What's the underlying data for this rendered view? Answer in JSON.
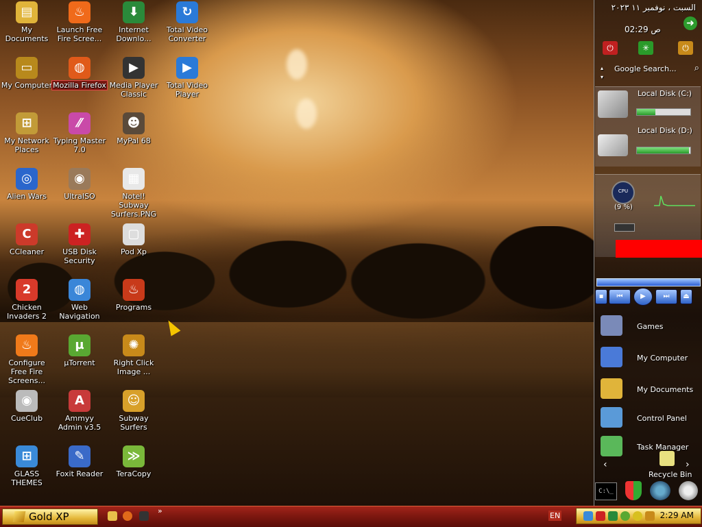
{
  "desktop": {
    "icons": [
      {
        "label": "My Documents",
        "icon": "folder-icon",
        "color": "#e0b43a",
        "glyph": "▤"
      },
      {
        "label": "My Computer",
        "icon": "computer-icon",
        "color": "#b8891c",
        "glyph": "▭"
      },
      {
        "label": "My Network Places",
        "icon": "network-icon",
        "color": "#c29b38",
        "glyph": "⊞"
      },
      {
        "label": "Alien Wars",
        "icon": "alien-wars-icon",
        "color": "#2a66cc",
        "glyph": "◎"
      },
      {
        "label": "CCleaner",
        "icon": "ccleaner-icon",
        "color": "#cc3a2a",
        "glyph": "C"
      },
      {
        "label": "Chicken Invaders 2",
        "icon": "chicken-icon",
        "color": "#d83a2a",
        "glyph": "2"
      },
      {
        "label": "Configure Free Fire Screens...",
        "icon": "fire-icon",
        "color": "#f07a1a",
        "glyph": "♨"
      },
      {
        "label": "CueClub",
        "icon": "cueclub-icon",
        "color": "#bbbbbb",
        "glyph": "◉"
      },
      {
        "label": "GLASS THEMES",
        "icon": "windows-icon",
        "color": "#3a8ad8",
        "glyph": "⊞"
      },
      {
        "label": "Launch Free Fire Scree...",
        "icon": "fire-icon",
        "color": "#f06a1a",
        "glyph": "♨"
      },
      {
        "label": "Mozilla Firefox",
        "icon": "firefox-icon",
        "color": "#e05a1a",
        "glyph": "◍",
        "selected": true
      },
      {
        "label": "Typing Master 7.0",
        "icon": "typing-master-icon",
        "color": "#c94aa8",
        "glyph": "⁄⁄"
      },
      {
        "label": "UltraISO",
        "icon": "disc-icon",
        "color": "#9a7a5a",
        "glyph": "◉"
      },
      {
        "label": "USB Disk Security",
        "icon": "shield-icon",
        "color": "#cc2222",
        "glyph": "✚"
      },
      {
        "label": "Web Navigation",
        "icon": "globe-icon",
        "color": "#3a86d8",
        "glyph": "◍"
      },
      {
        "label": "µTorrent",
        "icon": "utorrent-icon",
        "color": "#59a832",
        "glyph": "µ"
      },
      {
        "label": "Ammyy Admin v3.5",
        "icon": "ammyy-icon",
        "color": "#c83a3a",
        "glyph": "A"
      },
      {
        "label": "Foxit Reader",
        "icon": "foxit-icon",
        "color": "#3a6ac8",
        "glyph": "✎"
      },
      {
        "label": "Internet Downlo...",
        "icon": "idm-icon",
        "color": "#2a8a3a",
        "glyph": "⬇"
      },
      {
        "label": "Media Player Classic",
        "icon": "mpc-icon",
        "color": "#333333",
        "glyph": "▶"
      },
      {
        "label": "MyPal 68",
        "icon": "mypal-icon",
        "color": "#5a4a3a",
        "glyph": "☻"
      },
      {
        "label": "Notel! Subway Surfers.PNG",
        "icon": "image-file-icon",
        "color": "#e8e8e8",
        "glyph": "▦"
      },
      {
        "label": "Pod Xp",
        "icon": "pod-icon",
        "color": "#dddddd",
        "glyph": "▢"
      },
      {
        "label": "Programs",
        "icon": "programs-icon",
        "color": "#c83a1a",
        "glyph": "♨"
      },
      {
        "label": "Right Click Image ...",
        "icon": "gear-icon",
        "color": "#c88a1a",
        "glyph": "✺"
      },
      {
        "label": "Subway Surfers",
        "icon": "subway-icon",
        "color": "#d8a02a",
        "glyph": "☺"
      },
      {
        "label": "TeraCopy",
        "icon": "teracopy-icon",
        "color": "#7ab83a",
        "glyph": "≫"
      },
      {
        "label": "Total Video Converter",
        "icon": "tvc-icon",
        "color": "#2a7ad8",
        "glyph": "↻"
      },
      {
        "label": "Total Video Player",
        "icon": "tvp-icon",
        "color": "#2a7ad8",
        "glyph": "▶"
      }
    ]
  },
  "sidebar": {
    "date": "السبت ، نوفمبر ١١ ٢٠٢٣",
    "time": "02:29 ص",
    "search_placeholder": "Google Search...",
    "disk_c_label": "Local Disk (C:)",
    "disk_c_used": 0.35,
    "disk_d_label": "Local Disk (D:)",
    "disk_d_used": 0.97,
    "cpu_label": "CPU",
    "cpu_percent": "(9 %)",
    "launchers": [
      {
        "label": "Games",
        "icon": "games-icon"
      },
      {
        "label": "My Computer",
        "icon": "computer-icon"
      },
      {
        "label": "My Documents",
        "icon": "folder-icon"
      },
      {
        "label": "Control Panel",
        "icon": "control-panel-icon"
      },
      {
        "label": "Task Manager",
        "icon": "task-manager-icon"
      }
    ],
    "recycle_label": "Recycle Bin",
    "cmd_glyph": "C:\\_"
  },
  "taskbar": {
    "start_label": "Gold XP",
    "language": "EN",
    "clock": "2:29 AM",
    "overflow": "»"
  },
  "colors": {
    "taskbar": "#7e1810",
    "start": "#e5b83a",
    "selected_label": "#7a1a12"
  }
}
